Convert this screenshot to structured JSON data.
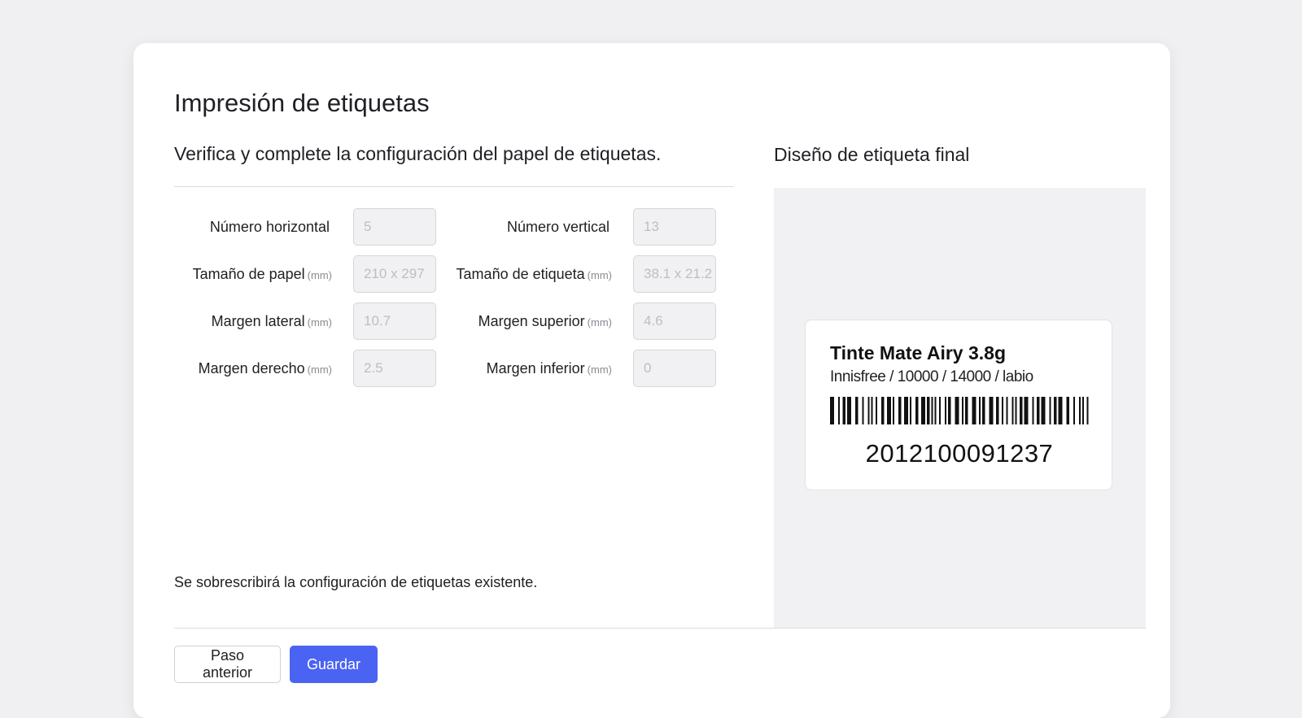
{
  "page": {
    "title": "Impresión de etiquetas",
    "subtitle": "Verifica y complete la configuración del papel de etiquetas.",
    "notice": "Se sobrescribirá la configuración de etiquetas existente."
  },
  "form": {
    "rows": [
      {
        "left": {
          "label": "Número horizontal",
          "unit": "",
          "value": "5"
        },
        "right": {
          "label": "Número vertical",
          "unit": "",
          "value": "13"
        }
      },
      {
        "left": {
          "label": "Tamaño de papel",
          "unit": "(mm)",
          "value": "210 x 297"
        },
        "right": {
          "label": "Tamaño de etiqueta",
          "unit": "(mm)",
          "value": "38.1 x 21.2"
        }
      },
      {
        "left": {
          "label": "Margen lateral",
          "unit": "(mm)",
          "value": "10.7"
        },
        "right": {
          "label": "Margen superior",
          "unit": "(mm)",
          "value": "4.6"
        }
      },
      {
        "left": {
          "label": "Margen derecho",
          "unit": "(mm)",
          "value": "2.5"
        },
        "right": {
          "label": "Margen inferior",
          "unit": "(mm)",
          "value": "0"
        }
      }
    ]
  },
  "preview": {
    "title": "Diseño de etiqueta final",
    "product_name": "Tinte Mate Airy 3.8g",
    "product_meta": "Innisfree / 10000 / 14000 / labio",
    "barcode_number": "2012100091237"
  },
  "buttons": {
    "prev_label": "Paso anterior",
    "save_label": "Guardar"
  },
  "colors": {
    "primary": "#4a63f2",
    "background": "#f0f0f2",
    "input_bg": "#f1f1f3"
  }
}
